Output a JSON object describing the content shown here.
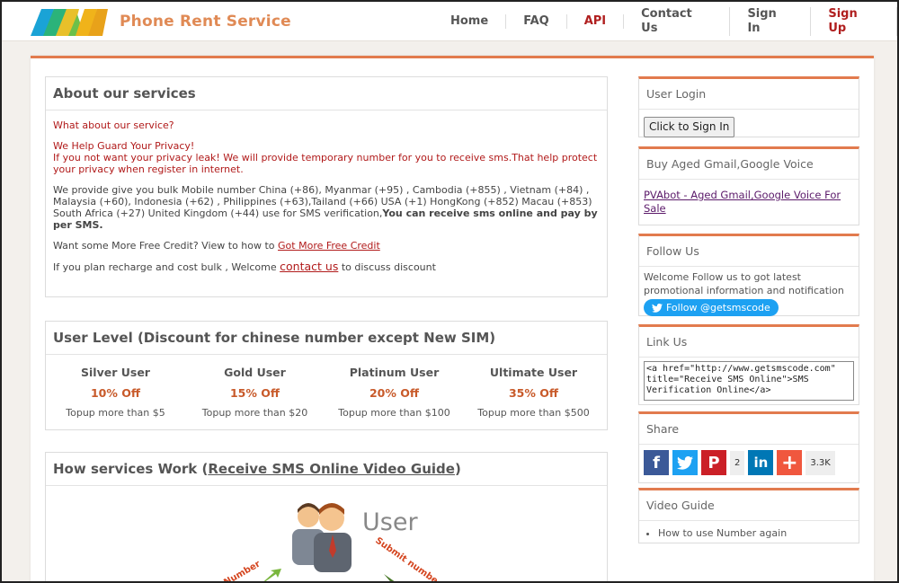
{
  "header": {
    "brand": "Phone Rent Service",
    "nav": [
      "Home",
      "FAQ",
      "API",
      "Contact Us",
      "Sign In",
      "Sign Up"
    ]
  },
  "about": {
    "title": "About our services",
    "q": "What about our service?",
    "guard_title": "We Help Guard Your Privacy!",
    "guard_text": "If you not want your privacy leak! We will provide temporary number for you to receive sms.That help protect your privacy when register in internet.",
    "bulk_text": "We provide give you bulk Mobile number China (+86), Myanmar (+95) , Cambodia (+855) , Vietnam (+84) , Malaysia (+60), Indonesia (+62) , Philippines (+63),Tailand (+66) USA (+1) HongKong (+852) Macau (+853) South Africa (+27) United Kingdom (+44) use for SMS verification,",
    "bulk_bold": "You can receive sms online and pay by per SMS.",
    "credit_text": "Want some More Free Credit? View to how to ",
    "credit_link": "Got More Free Credit",
    "recharge_text1": "If you plan recharge and cost bulk , Welcome ",
    "recharge_link": "contact us",
    "recharge_text2": " to discuss discount"
  },
  "levels": {
    "title": "User Level (Discount for chinese number except New SIM)",
    "items": [
      {
        "name": "Silver User",
        "off": "10% Off",
        "topup": "Topup more than $5"
      },
      {
        "name": "Gold User",
        "off": "15% Off",
        "topup": "Topup more than $20"
      },
      {
        "name": "Platinum User",
        "off": "20% Off",
        "topup": "Topup more than $100"
      },
      {
        "name": "Ultimate User",
        "off": "35% Off",
        "topup": "Topup more than $500"
      }
    ]
  },
  "how": {
    "title_prefix": "How services Work (",
    "title_link": "Receive SMS Online Video Guide",
    "title_suffix": ")",
    "diagram_user": "User",
    "diagram_left": "Number",
    "diagram_right": "Submit numbe"
  },
  "sidebar": {
    "login_title": "User Login",
    "login_button": "Click to Sign In",
    "gmail_title": "Buy Aged Gmail,Google Voice",
    "gmail_link": "PVAbot - Aged Gmail,Google Voice For Sale",
    "follow_title": "Follow Us",
    "follow_text": "Welcome Follow us to got latest promotional information and notification",
    "follow_button": "Follow @getsmscode",
    "link_title": "Link Us",
    "link_code": "<a href=\"http://www.getsmscode.com\" title=\"Receive SMS Online\">SMS Verification Online</a>",
    "share_title": "Share",
    "pin_count": "2",
    "share_count": "3.3K",
    "video_title": "Video Guide",
    "video_item": "How to use Number again"
  }
}
